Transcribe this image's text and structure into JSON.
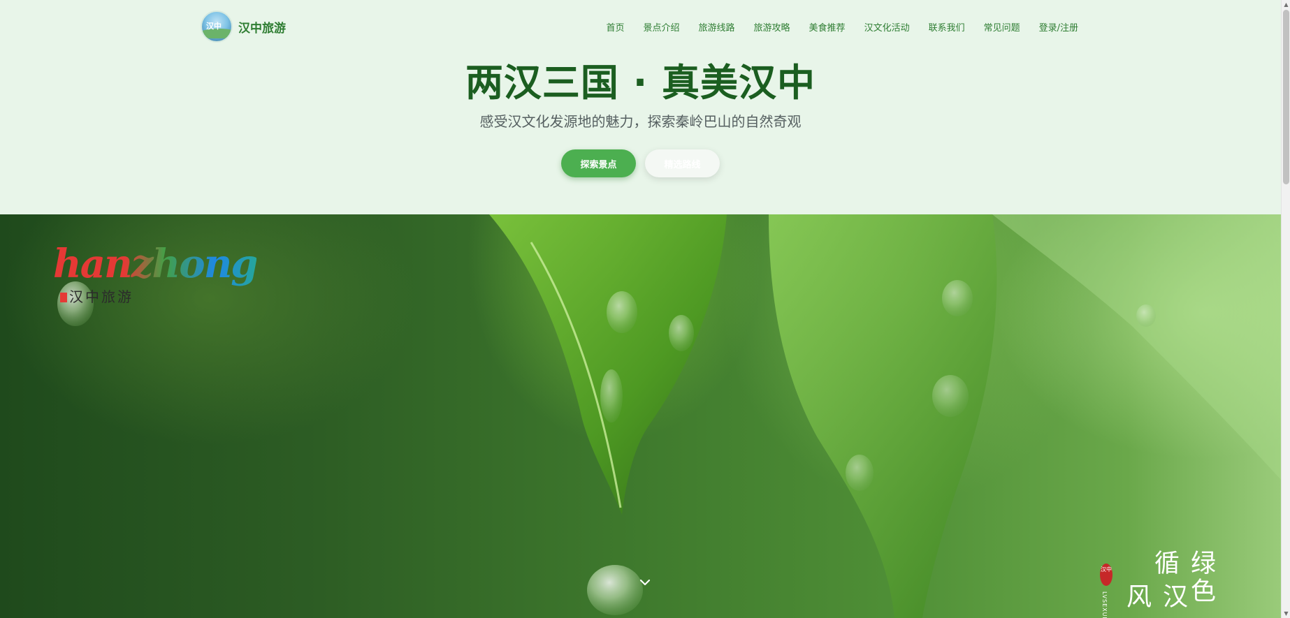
{
  "brand": {
    "logo_text": "汉中",
    "name": "汉中旅游"
  },
  "nav": {
    "items": [
      {
        "label": "首页"
      },
      {
        "label": "景点介绍"
      },
      {
        "label": "旅游线路"
      },
      {
        "label": "旅游攻略"
      },
      {
        "label": "美食推荐"
      },
      {
        "label": "汉文化活动"
      },
      {
        "label": "联系我们"
      },
      {
        "label": "常见问题"
      },
      {
        "label": "登录/注册"
      }
    ]
  },
  "hero": {
    "title": "两汉三国 · 真美汉中",
    "subtitle": "感受汉文化发源地的魅力，探索秦岭巴山的自然奇观",
    "primary_button": "探索景点",
    "secondary_button": "精选路线"
  },
  "banner": {
    "logo_script": "hanzhong",
    "logo_cn": "汉中旅游",
    "slogan_seal": "汉中",
    "slogan_col1": "绿色循",
    "slogan_col2": "汉风",
    "slogan_pinyin": "LVSEXUN",
    "scroll_icon": "chevron-down-icon"
  },
  "colors": {
    "accent": "#4caf50",
    "brand_text": "#2e7d32",
    "title": "#1b5e20",
    "background": "#e8f5e9"
  }
}
